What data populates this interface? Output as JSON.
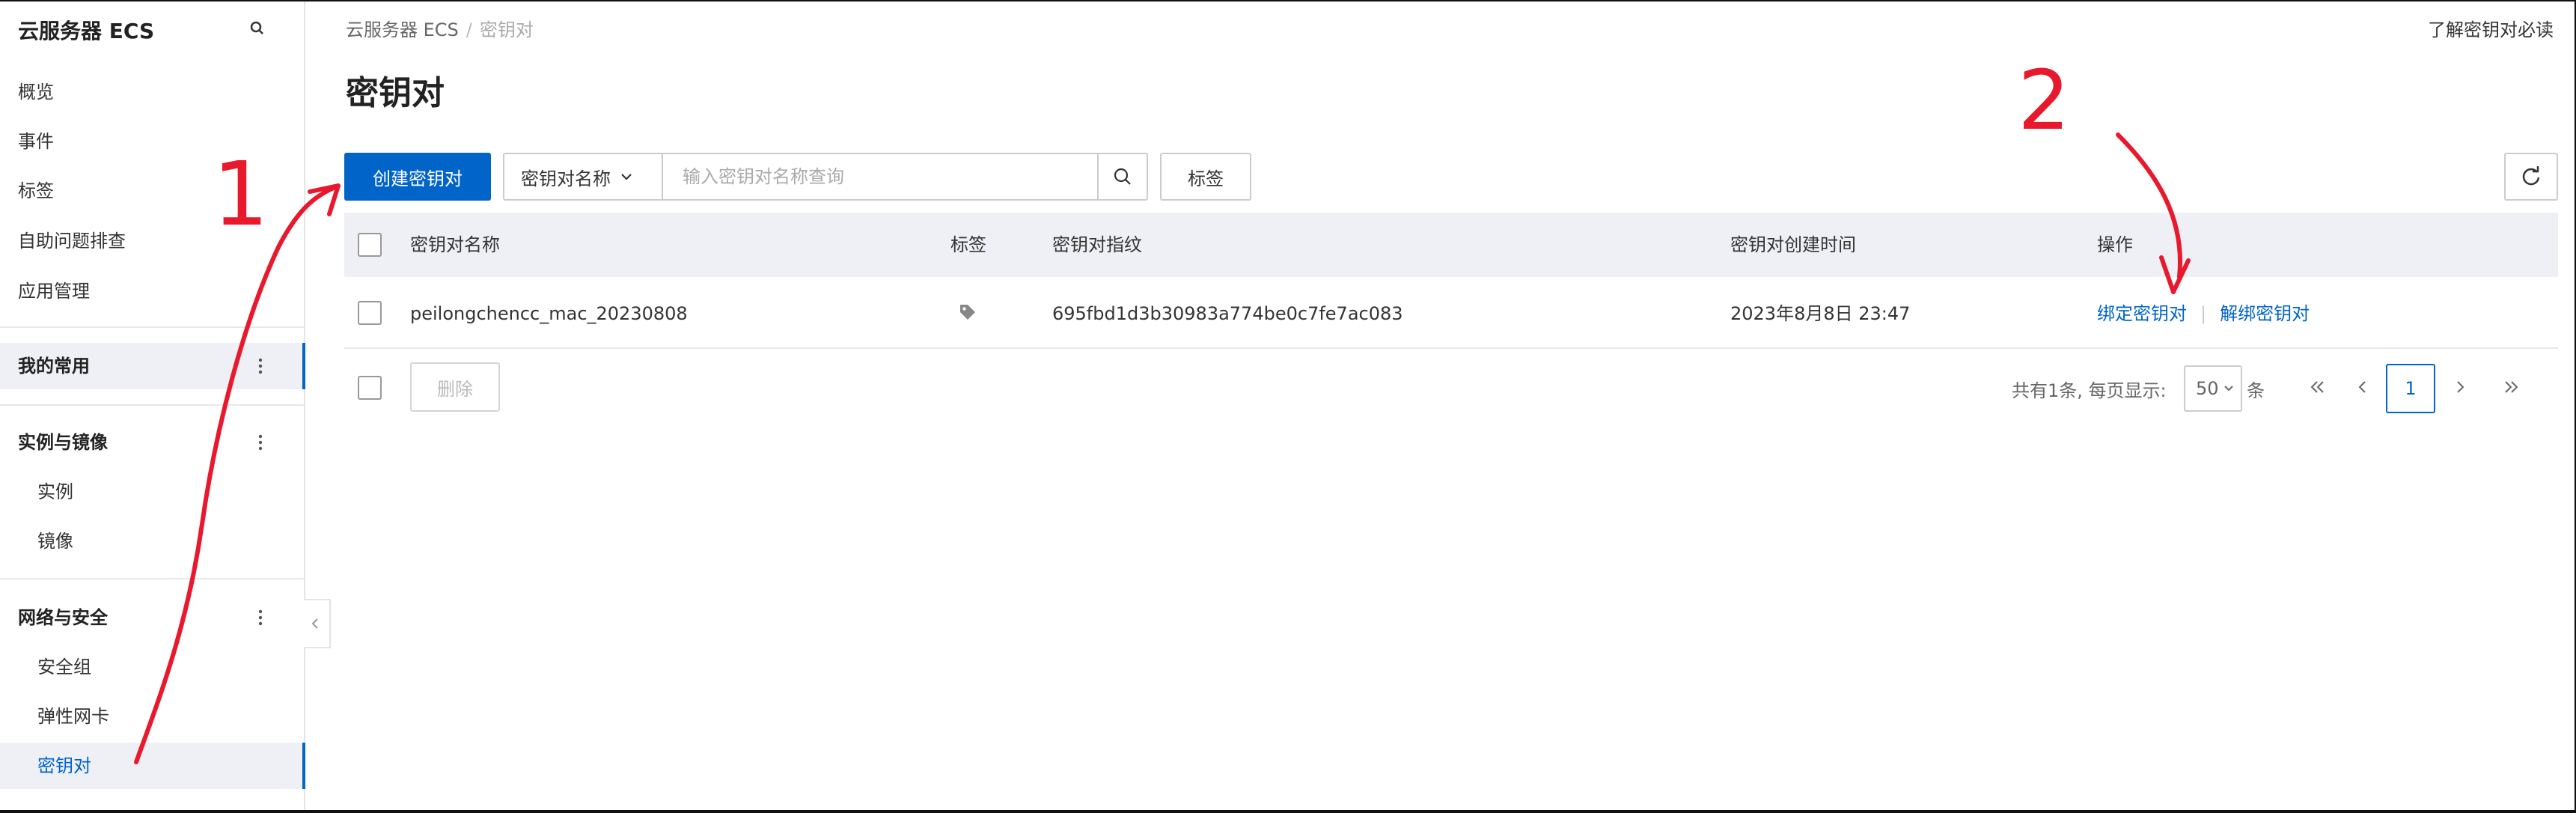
{
  "sidebar": {
    "title": "云服务器 ECS",
    "top_items": [
      "概览",
      "事件",
      "标签",
      "自助问题排查",
      "应用管理"
    ],
    "favorites": "我的常用",
    "group_instances": {
      "label": "实例与镜像",
      "items": [
        "实例",
        "镜像"
      ]
    },
    "group_network": {
      "label": "网络与安全",
      "items": [
        "安全组",
        "弹性网卡",
        "密钥对"
      ]
    }
  },
  "breadcrumb": {
    "root": "云服务器 ECS",
    "sep": "/",
    "current": "密钥对"
  },
  "help_link": "了解密钥对必读",
  "page_title": "密钥对",
  "toolbar": {
    "create_label": "创建密钥对",
    "search_field": "密钥对名称",
    "search_placeholder": "输入密钥对名称查询",
    "tag_label": "标签"
  },
  "table": {
    "headers": {
      "name": "密钥对名称",
      "tag": "标签",
      "fingerprint": "密钥对指纹",
      "created": "密钥对创建时间",
      "ops": "操作"
    },
    "rows": [
      {
        "name": "peilongchencc_mac_20230808",
        "fingerprint": "695fbd1d3b30983a774be0c7fe7ac083",
        "created": "2023年8月8日 23:47",
        "op_bind": "绑定密钥对",
        "op_unbind": "解绑密钥对"
      }
    ]
  },
  "footer": {
    "delete_label": "删除",
    "total_text": "共有1条, 每页显示:",
    "page_size": "50",
    "unit": "条",
    "current_page": "1"
  },
  "annotations": {
    "mark1": "1",
    "mark2": "2"
  },
  "colors": {
    "primary": "#0064c8",
    "annotation": "#e8192c",
    "header_bg": "#eef0f5"
  }
}
